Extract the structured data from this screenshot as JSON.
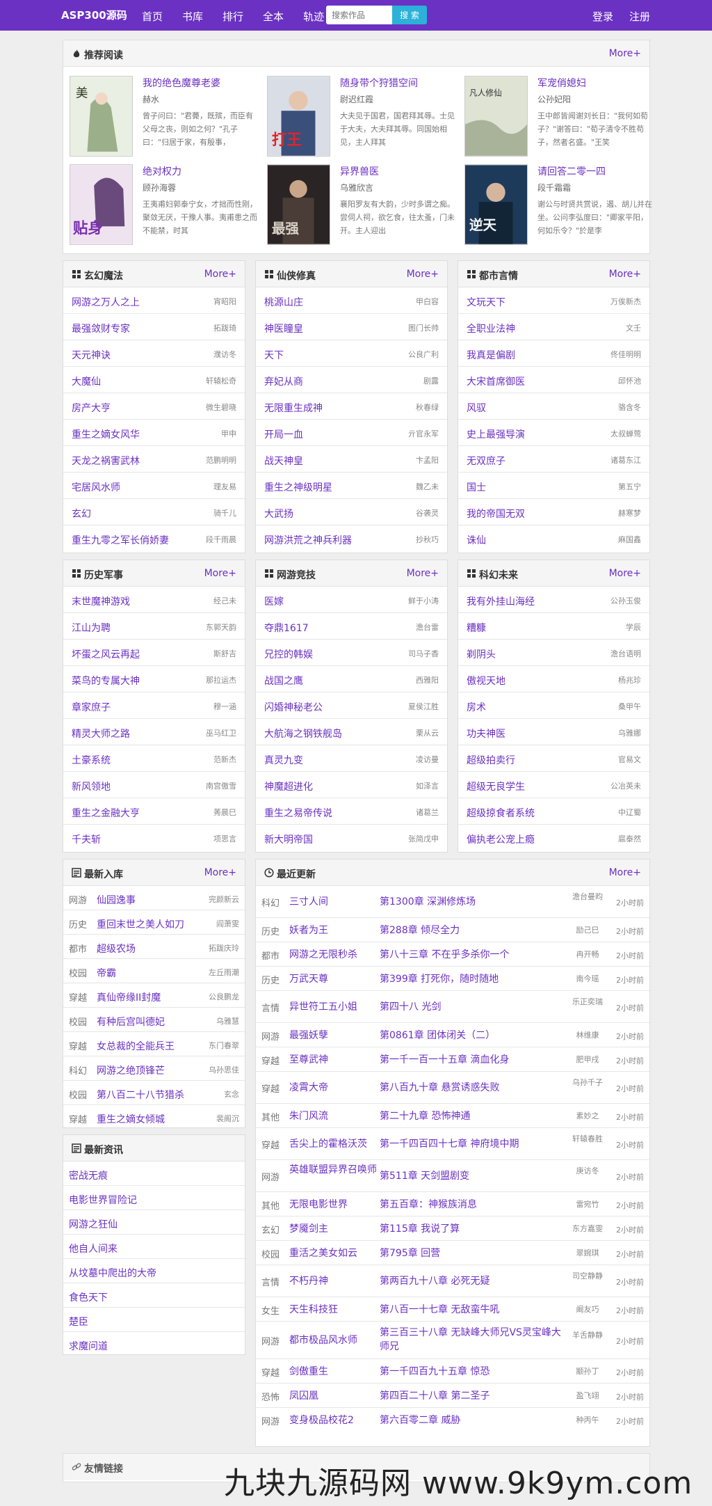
{
  "topbar": {
    "brand": "ASP300源码",
    "nav": [
      "首页",
      "书库",
      "排行",
      "全本",
      "轨迹"
    ],
    "search_placeholder": "搜索作品",
    "search_button": "搜 索",
    "login": "登录",
    "register": "注册"
  },
  "recommend": {
    "title": "推荐阅读",
    "more": "More+",
    "books": [
      {
        "title": "我的绝色魔尊老婆",
        "author": "赫水",
        "desc": "曾子问曰：\"君薨，既殡，而臣有父母之丧，则如之何？\"孔子曰：\"归居于家，有殷事，"
      },
      {
        "title": "随身带个狩猎空间",
        "author": "尉迟红霞",
        "desc": "大夫见于国君，国君拜其辱。士见于大夫，大夫拜其辱。同国始相见，主人拜其"
      },
      {
        "title": "军宠俏媳妇",
        "author": "公孙妃阳",
        "desc": "王中郎皆闻谢刘长日：\"我何如荀子？\"谢答曰：\"荀子清令不胜苟子，然者名盛。\"王笑"
      },
      {
        "title": "绝对权力",
        "author": "顾孙海蓉",
        "desc": "王夷甫妇郭泰宁女，才拙而性刚，聚敛无厌，干豫人事。夷甫患之而不能禁，时其"
      },
      {
        "title": "异界兽医",
        "author": "乌雅欣言",
        "desc": "襄阳罗友有大韵，少时多谓之痴。尝伺人祠，欲乞食，往太蚤，门未开。主人迎出"
      },
      {
        "title": "请回答二零一四",
        "author": "段千霜霜",
        "desc": "谢公与时贤共赏说，遏、胡儿并在坐。公问李弘度曰：\"卿家平阳，何如乐令？\"於是李"
      }
    ]
  },
  "categories": [
    {
      "title": "玄幻魔法",
      "more": "More+",
      "items": [
        {
          "t": "网游之万人之上",
          "a": "宵昭阳"
        },
        {
          "t": "最强敛财专家",
          "a": "拓跋琦"
        },
        {
          "t": "天元神诀",
          "a": "濮访冬"
        },
        {
          "t": "大魔仙",
          "a": "轩辕松奇"
        },
        {
          "t": "房产大亨",
          "a": "微生碧晓"
        },
        {
          "t": "重生之嫡女风华",
          "a": "甲申"
        },
        {
          "t": "天龙之祸害武林",
          "a": "范鹏明明"
        },
        {
          "t": "宅居风水师",
          "a": "理友易"
        },
        {
          "t": "玄幻",
          "a": "骑千儿"
        },
        {
          "t": "重生九零之军长俏娇妻",
          "a": "段千雨晨"
        }
      ]
    },
    {
      "title": "仙侠修真",
      "more": "More+",
      "items": [
        {
          "t": "桃源山庄",
          "a": "甲白容"
        },
        {
          "t": "神医瞳皇",
          "a": "图门长帅"
        },
        {
          "t": "天下",
          "a": "公良广利"
        },
        {
          "t": "弃妃从商",
          "a": "剧露"
        },
        {
          "t": "无限重生成神",
          "a": "秋春绿"
        },
        {
          "t": "开局一血",
          "a": "亓官永军"
        },
        {
          "t": "战天神皇",
          "a": "卞孟阳"
        },
        {
          "t": "重生之神级明星",
          "a": "魏乙未"
        },
        {
          "t": "大武扬",
          "a": "谷袭灵"
        },
        {
          "t": "网游洪荒之神兵利器",
          "a": "抄秋巧"
        }
      ]
    },
    {
      "title": "都市言情",
      "more": "More+",
      "items": [
        {
          "t": "文玩天下",
          "a": "万俟新杰"
        },
        {
          "t": "全职业法神",
          "a": "文壬"
        },
        {
          "t": "我真是偏剧",
          "a": "佟佳明明"
        },
        {
          "t": "大宋首席御医",
          "a": "邱怀池"
        },
        {
          "t": "风驭",
          "a": "骆含冬"
        },
        {
          "t": "史上最强导演",
          "a": "太叔蝉莺"
        },
        {
          "t": "无双庶子",
          "a": "诸葛东江"
        },
        {
          "t": "国士",
          "a": "第五宁"
        },
        {
          "t": "我的帝国无双",
          "a": "赫寒梦"
        },
        {
          "t": "诛仙",
          "a": "麻国鑫"
        }
      ]
    },
    {
      "title": "历史军事",
      "more": "More+",
      "items": [
        {
          "t": "末世魔神游戏",
          "a": "经己未"
        },
        {
          "t": "江山为聘",
          "a": "东郭天韵"
        },
        {
          "t": "坏蛋之风云再起",
          "a": "斯舒吉"
        },
        {
          "t": "菜鸟的专属大神",
          "a": "那拉运杰"
        },
        {
          "t": "章家庶子",
          "a": "穆一涵"
        },
        {
          "t": "精灵大师之路",
          "a": "巫马红卫"
        },
        {
          "t": "土豪系统",
          "a": "范新杰"
        },
        {
          "t": "新风领地",
          "a": "南宫傲雪"
        },
        {
          "t": "重生之金融大亨",
          "a": "莠晨巳"
        },
        {
          "t": "千夫斩",
          "a": "项思言"
        }
      ]
    },
    {
      "title": "网游竞技",
      "more": "More+",
      "items": [
        {
          "t": "医嫁",
          "a": "鲜于小涛"
        },
        {
          "t": "夺鼎1617",
          "a": "澹台雷"
        },
        {
          "t": "兄控的韩娱",
          "a": "司马子香"
        },
        {
          "t": "战国之鹰",
          "a": "西雅阳"
        },
        {
          "t": "闪婚神秘老公",
          "a": "夏侯江胜"
        },
        {
          "t": "大航海之钢铁舰岛",
          "a": "栗从云"
        },
        {
          "t": "真灵九变",
          "a": "凌访曼"
        },
        {
          "t": "神魔超进化",
          "a": "如泽言"
        },
        {
          "t": "重生之易帝传说",
          "a": "诸葛兰"
        },
        {
          "t": "新大明帝国",
          "a": "张简戊申"
        }
      ]
    },
    {
      "title": "科幻未来",
      "more": "More+",
      "items": [
        {
          "t": "我有外挂山海经",
          "a": "公孙玉俊"
        },
        {
          "t": "糟糠",
          "a": "学辰"
        },
        {
          "t": "剃阴头",
          "a": "澹台语明"
        },
        {
          "t": "傲视天地",
          "a": "杨兆珍"
        },
        {
          "t": "房术",
          "a": "桑甲午"
        },
        {
          "t": "功夫神医",
          "a": "乌雅娜"
        },
        {
          "t": "超级拍卖行",
          "a": "官易文"
        },
        {
          "t": "超级无良学生",
          "a": "公冶英未"
        },
        {
          "t": "超级掠食者系统",
          "a": "中辽蜀"
        },
        {
          "t": "偏执老公宠上瘾",
          "a": "扈泰然"
        }
      ]
    }
  ],
  "new_books": {
    "title": "最新入库",
    "more": "More+",
    "items": [
      {
        "c": "网游",
        "t": "仙园逸事",
        "a": "完颜新云"
      },
      {
        "c": "历史",
        "t": "重回末世之美人如刀",
        "a": "阎萧雯"
      },
      {
        "c": "都市",
        "t": "超级农场",
        "a": "拓跋庆玲"
      },
      {
        "c": "校园",
        "t": "帝霸",
        "a": "左丘雨潮"
      },
      {
        "c": "穿越",
        "t": "真仙帝缘II封魔",
        "a": "公良鹏龙"
      },
      {
        "c": "校园",
        "t": "有种后宫叫德妃",
        "a": "乌雅慧"
      },
      {
        "c": "穿越",
        "t": "女总裁的全能兵王",
        "a": "东门春翠"
      },
      {
        "c": "科幻",
        "t": "网游之绝顶锋芒",
        "a": "乌孙思佳"
      },
      {
        "c": "校园",
        "t": "第八百二十八节猎杀",
        "a": "玄念"
      },
      {
        "c": "穿越",
        "t": "重生之嫡女倾城",
        "a": "裴阁沉"
      }
    ]
  },
  "news": {
    "title": "最新资讯",
    "items": [
      "密战无痕",
      "电影世界冒险记",
      "网游之狂仙",
      "他自人间来",
      "从坟墓中爬出的大帝",
      "食色天下",
      "楚臣",
      "求魔问道"
    ]
  },
  "updates": {
    "title": "最近更新",
    "more": "More+",
    "items": [
      {
        "c": "科幻",
        "b": "三寸人间",
        "ch": "第1300章 深渊修炼场",
        "a": "澹台曼昀",
        "tm": "2小时前"
      },
      {
        "c": "历史",
        "b": "妖者为王",
        "ch": "第288章 倾尽全力",
        "a": "励己巳",
        "tm": "2小时前"
      },
      {
        "c": "都市",
        "b": "网游之无限秒杀",
        "ch": "第八十三章 不在乎多杀你一个",
        "a": "冉开畅",
        "tm": "2小时前"
      },
      {
        "c": "历史",
        "b": "万武天尊",
        "ch": "第399章 打死你，随时随地",
        "a": "南今瑶",
        "tm": "2小时前"
      },
      {
        "c": "言情",
        "b": "异世符工五小姐",
        "ch": "第四十八 光剑",
        "a": "乐正奕瑞",
        "tm": "2小时前"
      },
      {
        "c": "网游",
        "b": "最强妖孽",
        "ch": "第0861章 团体闭关（二）",
        "a": "林维康",
        "tm": "2小时前"
      },
      {
        "c": "穿越",
        "b": "至尊武神",
        "ch": "第一千一百一十五章 滴血化身",
        "a": "肥甲戌",
        "tm": "2小时前"
      },
      {
        "c": "穿越",
        "b": "凌霄大帝",
        "ch": "第八百九十章 悬赏诱惑失败",
        "a": "乌孙千子",
        "tm": "2小时前"
      },
      {
        "c": "其他",
        "b": "朱门风流",
        "ch": "第二十九章 恐怖神通",
        "a": "素妙之",
        "tm": "2小时前"
      },
      {
        "c": "穿越",
        "b": "舌尖上的霍格沃茨",
        "ch": "第一千四百四十七章 神府境中期",
        "a": "轩辕春胜",
        "tm": "2小时前"
      },
      {
        "c": "网游",
        "b": "英雄联盟异界召唤师",
        "ch": "第511章 天剑盟剧变",
        "a": "庚访冬",
        "tm": "2小时前"
      },
      {
        "c": "其他",
        "b": "无限电影世界",
        "ch": "第五百章：神猴族消息",
        "a": "雷宛竹",
        "tm": "2小时前"
      },
      {
        "c": "玄幻",
        "b": "梦魇剑主",
        "ch": "第115章 我说了算",
        "a": "东方嘉雯",
        "tm": "2小时前"
      },
      {
        "c": "校园",
        "b": "重活之美女如云",
        "ch": "第795章 回营",
        "a": "翠婉琪",
        "tm": "2小时前"
      },
      {
        "c": "言情",
        "b": "不朽丹神",
        "ch": "第两百九十八章 必死无疑",
        "a": "司空静静",
        "tm": "2小时前"
      },
      {
        "c": "女生",
        "b": "天生科技狂",
        "ch": "第八百一十七章 无敌蛮牛吼",
        "a": "阚友巧",
        "tm": "2小时前"
      },
      {
        "c": "网游",
        "b": "都市极品风水师",
        "ch": "第三百三十八章 无缺峰大师兄VS灵宝峰大师兄",
        "a": "羊舌静静",
        "tm": "2小时前"
      },
      {
        "c": "穿越",
        "b": "剑傲重生",
        "ch": "第一千四百九十五章 惊恐",
        "a": "颛孙丁",
        "tm": "2小时前"
      },
      {
        "c": "恐怖",
        "b": "凤囚凰",
        "ch": "第四百二十八章 第二圣子",
        "a": "盈飞翊",
        "tm": "2小时前"
      },
      {
        "c": "网游",
        "b": "变身极品校花2",
        "ch": "第六百零二章 威胁",
        "a": "种丙午",
        "tm": "2小时前"
      }
    ]
  },
  "links": {
    "title": "友情链接"
  },
  "watermark": "九块九源码网 www.9k9ym.com",
  "colors": {
    "brand": "#6b31c2",
    "search_button": "#2cb1d8"
  }
}
